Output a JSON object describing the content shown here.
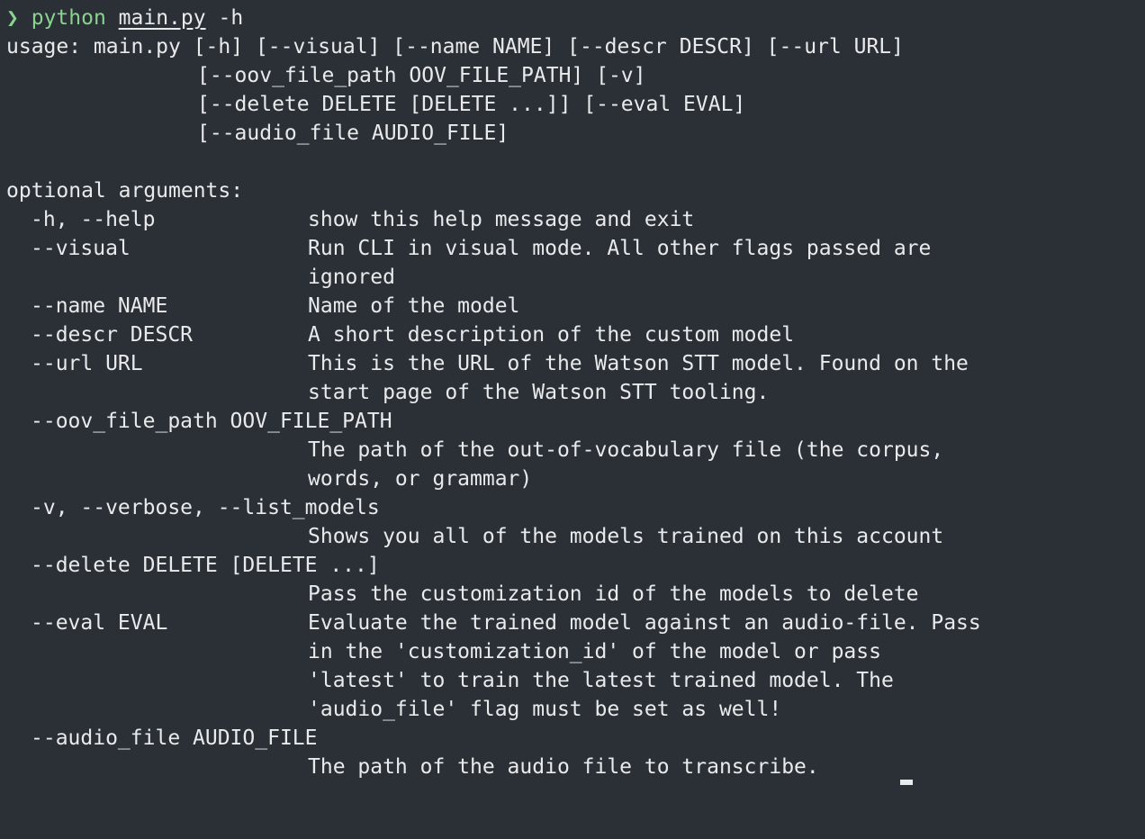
{
  "prompt": {
    "symbol": "❯",
    "command": "python",
    "file": "main.py",
    "flag": "-h"
  },
  "usage": [
    "usage: main.py [-h] [--visual] [--name NAME] [--descr DESCR] [--url URL]",
    "[--oov_file_path OOV_FILE_PATH] [-v]",
    "[--delete DELETE [DELETE ...]] [--eval EVAL]",
    "[--audio_file AUDIO_FILE]"
  ],
  "section_title": "optional arguments:",
  "options": [
    {
      "flag": "-h, --help",
      "desc": [
        "show this help message and exit"
      ]
    },
    {
      "flag": "--visual",
      "desc": [
        "Run CLI in visual mode. All other flags passed are",
        "ignored"
      ]
    },
    {
      "flag": "--name NAME",
      "desc": [
        "Name of the model"
      ]
    },
    {
      "flag": "--descr DESCR",
      "desc": [
        "A short description of the custom model"
      ]
    },
    {
      "flag": "--url URL",
      "desc": [
        "This is the URL of the Watson STT model. Found on the",
        "start page of the Watson STT tooling."
      ]
    },
    {
      "flag": "--oov_file_path OOV_FILE_PATH",
      "desc": [
        "The path of the out-of-vocabulary file (the corpus,",
        "words, or grammar)"
      ]
    },
    {
      "flag": "-v, --verbose, --list_models",
      "desc": [
        "Shows you all of the models trained on this account"
      ]
    },
    {
      "flag": "--delete DELETE [DELETE ...]",
      "desc": [
        "Pass the customization id of the models to delete"
      ]
    },
    {
      "flag": "--eval EVAL",
      "desc": [
        "Evaluate the trained model against an audio-file. Pass",
        "in the 'customization_id' of the model or pass",
        "'latest' to train the latest trained model. The",
        "'audio_file' flag must be set as well!"
      ]
    },
    {
      "flag": "--audio_file AUDIO_FILE",
      "desc": [
        "The path of the audio file to transcribe."
      ]
    }
  ],
  "colors": {
    "background": "#2b3036",
    "foreground": "#e9eaec",
    "prompt": "#8ad28f"
  }
}
